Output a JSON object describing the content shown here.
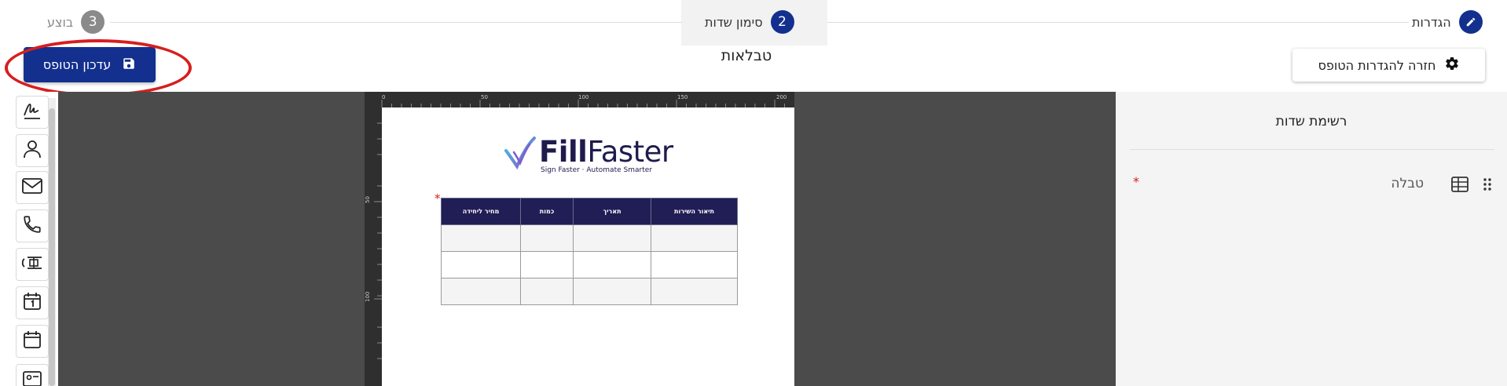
{
  "stepper": {
    "steps": [
      {
        "number": "",
        "label": "הגדרות",
        "state": "done",
        "icon": "pencil-icon"
      },
      {
        "number": "2",
        "label": "סימון שדות",
        "state": "active"
      },
      {
        "number": "3",
        "label": "בוצע",
        "state": "future"
      }
    ]
  },
  "toolbar": {
    "update_label": "עדכון הטופס",
    "update_icon": "save-icon",
    "back_label": "חזרה להגדרות הטופס",
    "back_icon": "gear-icon"
  },
  "page": {
    "title": "טבלאות"
  },
  "tools": [
    {
      "icon": "signature-icon"
    },
    {
      "icon": "person-icon"
    },
    {
      "icon": "mail-icon"
    },
    {
      "icon": "phone-icon"
    },
    {
      "icon": "id-number-icon"
    },
    {
      "icon": "calendar-day-icon"
    },
    {
      "icon": "calendar-icon"
    },
    {
      "icon": "contact-card-icon"
    }
  ],
  "ruler": {
    "top_ticks": [
      "0",
      "50",
      "100",
      "150",
      "200"
    ],
    "left_ticks": [
      "50",
      "100"
    ]
  },
  "document": {
    "logo": {
      "brand_bold": "Fill",
      "brand_light": "Faster",
      "tagline": "Sign Faster · Automate Smarter"
    },
    "required_marker": "*",
    "table": {
      "headers": [
        "תיאור השירות",
        "תאריך",
        "כמות",
        "מחיר ליחידה"
      ],
      "rows": [
        [
          "",
          "",
          "",
          ""
        ],
        [
          "",
          "",
          "",
          ""
        ],
        [
          "",
          "",
          "",
          ""
        ]
      ]
    }
  },
  "panel": {
    "title": "רשימת שדות",
    "fields": [
      {
        "label": "טבלה",
        "icon": "table-icon",
        "required_marker": "*"
      }
    ]
  },
  "colors": {
    "primary": "#13308e",
    "highlight": "#d71e1e",
    "table_header": "#211d55",
    "canvas": "#4b4b4b"
  }
}
